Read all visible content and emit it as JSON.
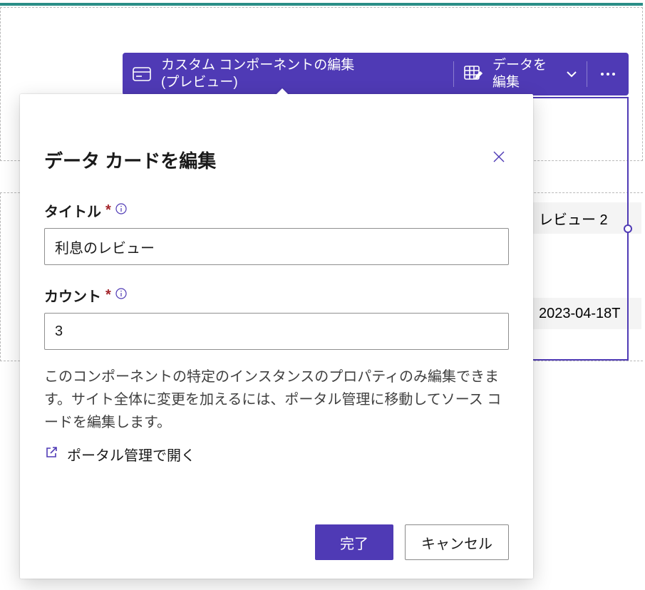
{
  "toolbar": {
    "title_line1": "カスタム コンポーネントの編集",
    "title_line2": "(プレビュー)",
    "edit_data_line1": "データを",
    "edit_data_line2": "編集"
  },
  "background": {
    "cell_review2": "レビュー 2",
    "cell_date": "2023-04-18T"
  },
  "dialog": {
    "title": "データ カードを編集",
    "fields": {
      "title": {
        "label": "タイトル",
        "value": "利息のレビュー"
      },
      "count": {
        "label": "カウント",
        "value": "3"
      }
    },
    "help_text": "このコンポーネントの特定のインスタンスのプロパティのみ編集できます。サイト全体に変更を加えるには、ポータル管理に移動してソース コードを編集します。",
    "open_portal_label": "ポータル管理で開く",
    "done_label": "完了",
    "cancel_label": "キャンセル"
  }
}
